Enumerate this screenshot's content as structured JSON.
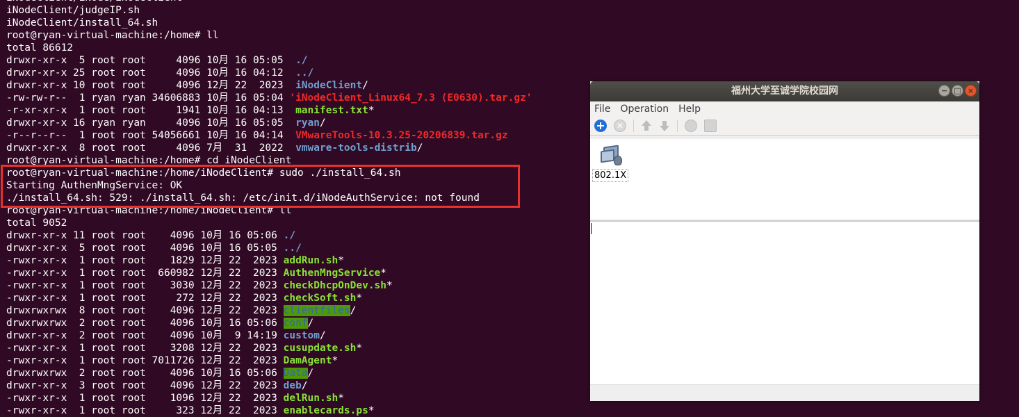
{
  "terminal": {
    "lines": [
      [
        {
          "t": "iNodeClient/iNode/iNodeClient",
          "c": ""
        }
      ],
      [
        {
          "t": "iNodeClient/judgeIP.sh",
          "c": ""
        }
      ],
      [
        {
          "t": "iNodeClient/install_64.sh",
          "c": ""
        }
      ],
      [
        {
          "t": "root@ryan-virtual-machine:/home# ll",
          "c": ""
        }
      ],
      [
        {
          "t": "total 86612",
          "c": ""
        }
      ],
      [
        {
          "t": "drwxr-xr-x  5 root root     4096 10月 16 05:05  ",
          "c": ""
        },
        {
          "t": "./",
          "c": "dir"
        }
      ],
      [
        {
          "t": "drwxr-xr-x 25 root root     4096 10月 16 04:12  ",
          "c": ""
        },
        {
          "t": "../",
          "c": "dir"
        }
      ],
      [
        {
          "t": "drwxr-xr-x 10 root root     4096 12月 22  2023  ",
          "c": ""
        },
        {
          "t": "iNodeClient",
          "c": "dir"
        },
        {
          "t": "/",
          "c": ""
        }
      ],
      [
        {
          "t": "-rw-rw-r--  1 ryan ryan 34606883 10月 16 05:04 ",
          "c": ""
        },
        {
          "t": "'iNodeClient_Linux64_7.3 (E0630).tar.gz'",
          "c": "arc"
        }
      ],
      [
        {
          "t": "-r-xr-xr-x  1 root root     1941 10月 16 04:13  ",
          "c": ""
        },
        {
          "t": "manifest.txt",
          "c": "exe"
        },
        {
          "t": "*",
          "c": ""
        }
      ],
      [
        {
          "t": "drwxr-xr-x 16 ryan ryan     4096 10月 16 05:05  ",
          "c": ""
        },
        {
          "t": "ryan",
          "c": "dir"
        },
        {
          "t": "/",
          "c": ""
        }
      ],
      [
        {
          "t": "-r--r--r--  1 root root 54056661 10月 16 04:14  ",
          "c": ""
        },
        {
          "t": "VMwareTools-10.3.25-20206839.tar.gz",
          "c": "arc"
        }
      ],
      [
        {
          "t": "drwxr-xr-x  8 root root     4096 7月  31  2022  ",
          "c": ""
        },
        {
          "t": "vmware-tools-distrib",
          "c": "dir"
        },
        {
          "t": "/",
          "c": ""
        }
      ],
      [
        {
          "t": "root@ryan-virtual-machine:/home# cd iNodeClient",
          "c": ""
        }
      ],
      [
        {
          "t": "root@ryan-virtual-machine:/home/iNodeClient# sudo ./install_64.sh",
          "c": ""
        }
      ],
      [
        {
          "t": "Starting AuthenMngService: OK",
          "c": ""
        }
      ],
      [
        {
          "t": "./install_64.sh: 529: ./install_64.sh: /etc/init.d/iNodeAuthService: not found",
          "c": ""
        }
      ],
      [
        {
          "t": "root@ryan-virtual-machine:/home/iNodeClient# ll",
          "c": ""
        }
      ],
      [
        {
          "t": "total 9052",
          "c": ""
        }
      ],
      [
        {
          "t": "drwxr-xr-x 11 root root    4096 10月 16 05:06 ",
          "c": ""
        },
        {
          "t": "./",
          "c": "dir"
        }
      ],
      [
        {
          "t": "drwxr-xr-x  5 root root    4096 10月 16 05:05 ",
          "c": ""
        },
        {
          "t": "../",
          "c": "dir"
        }
      ],
      [
        {
          "t": "-rwxr-xr-x  1 root root    1829 12月 22  2023 ",
          "c": ""
        },
        {
          "t": "addRun.sh",
          "c": "exe"
        },
        {
          "t": "*",
          "c": ""
        }
      ],
      [
        {
          "t": "-rwxr-xr-x  1 root root  660982 12月 22  2023 ",
          "c": ""
        },
        {
          "t": "AuthenMngService",
          "c": "exe"
        },
        {
          "t": "*",
          "c": ""
        }
      ],
      [
        {
          "t": "-rwxr-xr-x  1 root root    3030 12月 22  2023 ",
          "c": ""
        },
        {
          "t": "checkDhcpOnDev.sh",
          "c": "exe"
        },
        {
          "t": "*",
          "c": ""
        }
      ],
      [
        {
          "t": "-rwxr-xr-x  1 root root     272 12月 22  2023 ",
          "c": ""
        },
        {
          "t": "checkSoft.sh",
          "c": "exe"
        },
        {
          "t": "*",
          "c": ""
        }
      ],
      [
        {
          "t": "drwxrwxrwx  8 root root    4096 12月 22  2023 ",
          "c": ""
        },
        {
          "t": "clientfiles",
          "c": "swdir"
        },
        {
          "t": "/",
          "c": ""
        }
      ],
      [
        {
          "t": "drwxrwxrwx  2 root root    4096 10月 16 05:06 ",
          "c": ""
        },
        {
          "t": "conf",
          "c": "swdir"
        },
        {
          "t": "/",
          "c": ""
        }
      ],
      [
        {
          "t": "drwxr-xr-x  2 root root    4096 10月  9 14:19 ",
          "c": ""
        },
        {
          "t": "custom",
          "c": "dir"
        },
        {
          "t": "/",
          "c": ""
        }
      ],
      [
        {
          "t": "-rwxr-xr-x  1 root root    3208 12月 22  2023 ",
          "c": ""
        },
        {
          "t": "cusupdate.sh",
          "c": "exe"
        },
        {
          "t": "*",
          "c": ""
        }
      ],
      [
        {
          "t": "-rwxr-xr-x  1 root root 7011726 12月 22  2023 ",
          "c": ""
        },
        {
          "t": "DamAgent",
          "c": "exe"
        },
        {
          "t": "*",
          "c": ""
        }
      ],
      [
        {
          "t": "drwxrwxrwx  2 root root    4096 10月 16 05:06 ",
          "c": ""
        },
        {
          "t": "Data",
          "c": "swdir"
        },
        {
          "t": "/",
          "c": ""
        }
      ],
      [
        {
          "t": "drwxr-xr-x  3 root root    4096 12月 22  2023 ",
          "c": ""
        },
        {
          "t": "deb",
          "c": "dir"
        },
        {
          "t": "/",
          "c": ""
        }
      ],
      [
        {
          "t": "-rwxr-xr-x  1 root root    1096 12月 22  2023 ",
          "c": ""
        },
        {
          "t": "delRun.sh",
          "c": "exe"
        },
        {
          "t": "*",
          "c": ""
        }
      ],
      [
        {
          "t": "-rwxr-xr-x  1 root root     323 12月 22  2023 ",
          "c": ""
        },
        {
          "t": "enablecards.ps",
          "c": "exe"
        },
        {
          "t": "*",
          "c": ""
        }
      ]
    ]
  },
  "inode_window": {
    "title": "福州大学至诚学院校园网",
    "controls": {
      "minimize": "−",
      "maximize": "□",
      "close": "×"
    },
    "menu": [
      "File",
      "Operation",
      "Help"
    ],
    "connection": {
      "label": "802.1X",
      "icon": "network-connection-icon"
    }
  },
  "colors": {
    "terminal_bg": "#300a24",
    "dir": "#729fcf",
    "exe": "#8ae234",
    "archive": "#ef2929",
    "highlight_box": "#e8312b"
  }
}
